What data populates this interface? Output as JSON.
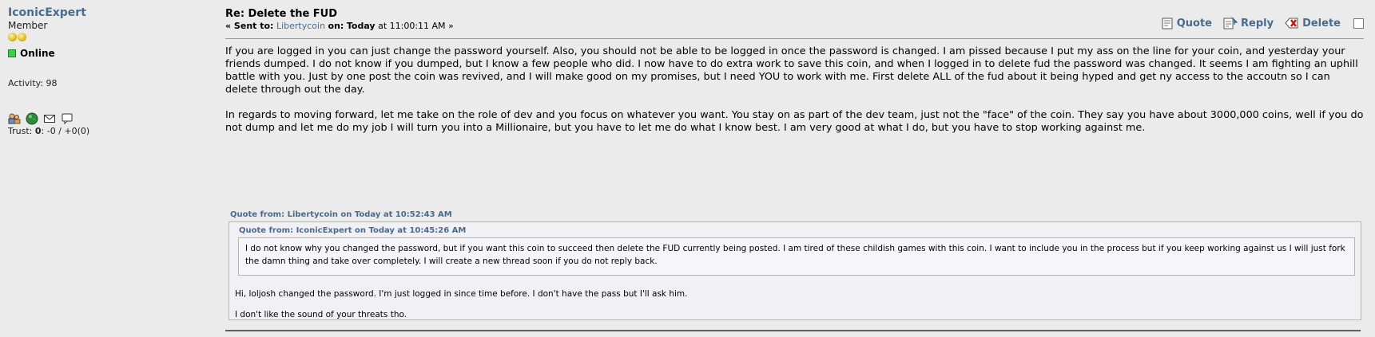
{
  "poster": {
    "username": "IconicExpert",
    "rank": "Member",
    "status": "Online",
    "activity": "Activity: 98",
    "trust_label": "Trust:",
    "trust_score": "0",
    "trust_detail": ": -0 / +0(0)",
    "icons": [
      "profile-icon",
      "website-globe-icon",
      "email-icon",
      "message-icon"
    ]
  },
  "post": {
    "subject": "Re: Delete the FUD",
    "meta_prefix": "« Sent to:",
    "recipient": "Libertycoin",
    "meta_on": "on:",
    "meta_today": "Today",
    "meta_time": "at 11:00:11 AM »",
    "actions": {
      "quote": "Quote",
      "reply": "Reply",
      "delete": "Delete"
    },
    "paragraphs": [
      "If you are logged in you can just change the password yourself. Also, you should not be able to be logged in once the password is changed. I am pissed because I put my ass on the line for your coin, and yesterday your friends dumped. I do not know if you dumped, but I know a few people who did. I now have to do extra work to save this coin, and when I logged in to delete fud the password was changed. It seems I am fighting an uphill battle with you. Just by one post the coin was revived, and I will make good on my promises, but I need YOU to work with me. First delete ALL of the fud about it being hyped and get ny access to the accoutn so I can delete through out the day.",
      "In regards to moving forward, let me take on the role of dev and you focus on whatever you want. You stay on as part of the dev team, just not the \"face\" of the coin. They say you have about 3000,000 coins, well if you do not dump and let me do my job I will turn you into a Millionaire, but you have to let me do what I know best. I am very good at what I do, but you have to stop working against me."
    ],
    "quote_outer": {
      "header": "Quote from: Libertycoin on Today at 10:52:43 AM",
      "lines": [
        "Hi, loljosh changed the password. I'm just logged in since time before. I don't have the pass but I'll ask him.",
        "I don't like the sound of your threats tho."
      ]
    },
    "quote_inner": {
      "header": "Quote from: IconicExpert on Today at 10:45:26 AM",
      "text": "I do not know why you changed the password, but if you want this coin to succeed then delete the FUD currently being posted. I am tired of these childish games with this coin. I want to include you in the process but if you keep working against us I will just fork the damn thing and take over completely. I will create a new thread soon if you do not reply back."
    }
  },
  "colors": {
    "link": "#476c8e",
    "background": "#ebebeb",
    "online": "#3bd04a"
  }
}
